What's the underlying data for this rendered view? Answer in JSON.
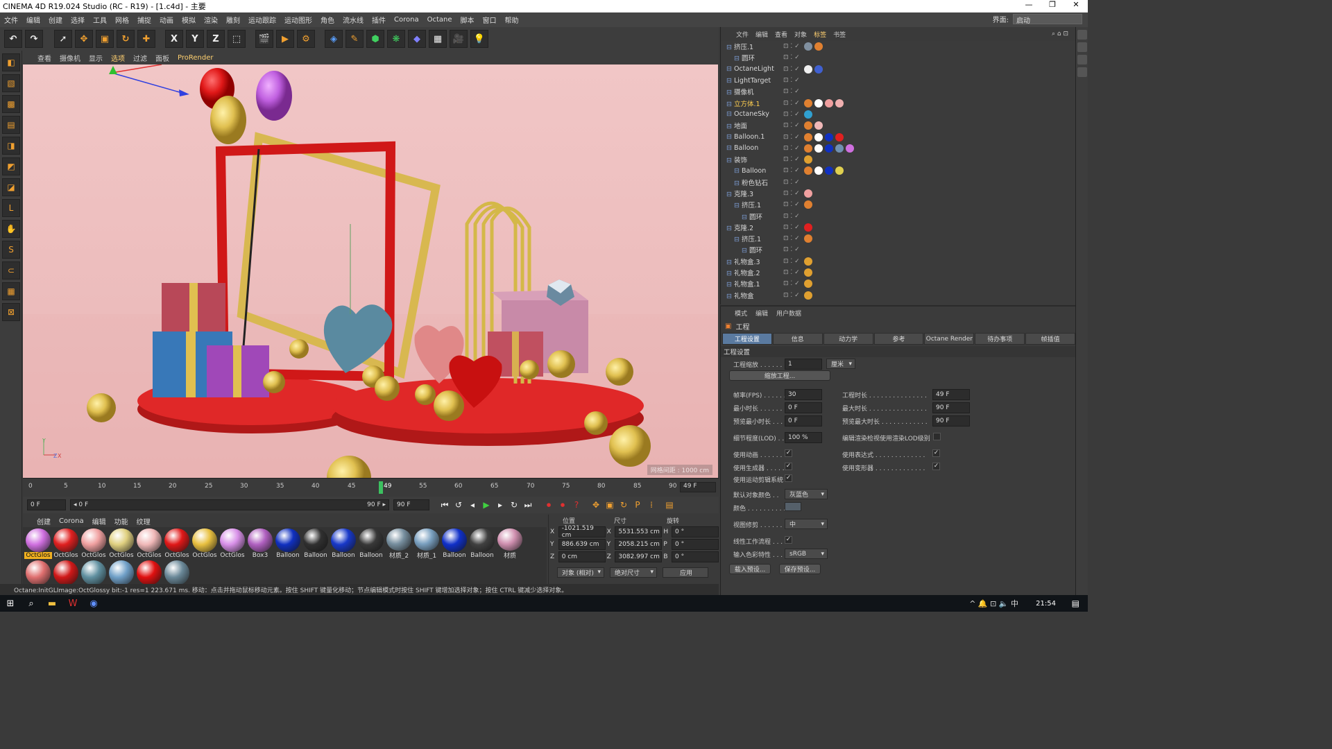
{
  "window": {
    "title": "CINEMA 4D R19.024 Studio (RC - R19) - [1.c4d] - 主要",
    "controls": [
      "—",
      "❐",
      "✕"
    ]
  },
  "menubar": {
    "items": [
      "文件",
      "编辑",
      "创建",
      "选择",
      "工具",
      "网格",
      "捕捉",
      "动画",
      "模拟",
      "渲染",
      "雕刻",
      "运动跟踪",
      "运动图形",
      "角色",
      "流水线",
      "插件",
      "Corona",
      "Octane",
      "脚本",
      "窗口",
      "帮助"
    ],
    "layout_label": "界面:",
    "layout_value": "启动"
  },
  "toolbar": {
    "icons": [
      "undo-icon",
      "redo-icon",
      "select-icon",
      "move-icon",
      "scale-icon",
      "rotate-icon",
      "move-add-icon",
      "x-axis-icon",
      "y-axis-icon",
      "z-axis-icon",
      "coord-system-icon",
      "render-view-icon",
      "render-picture-icon",
      "render-settings-icon",
      "cube-icon",
      "pen-icon",
      "subdivide-icon",
      "array-icon",
      "deformer-icon",
      "floor-icon",
      "camera-icon",
      "light-icon"
    ],
    "axis_labels": [
      "X",
      "Y",
      "Z"
    ]
  },
  "viewport": {
    "menu": [
      "查看",
      "摄像机",
      "显示",
      "选项",
      "过滤",
      "面板",
      "ProRender"
    ],
    "info": "网格间距 : 1000 cm",
    "axis_y": "Y",
    "axis_z": "Z",
    "axis_x": "X"
  },
  "timeline": {
    "ticks": [
      "0",
      "5",
      "10",
      "15",
      "20",
      "25",
      "30",
      "35",
      "40",
      "45",
      "49",
      "55",
      "60",
      "65",
      "70",
      "75",
      "80",
      "85",
      "90"
    ],
    "current_frame": "49 F",
    "start_field": "0 F",
    "range_start": "◂ 0 F",
    "range_end": "90 F ▸",
    "end_field": "90 F"
  },
  "material_menu": [
    "创建",
    "Corona",
    "编辑",
    "功能",
    "纹理"
  ],
  "materials": [
    {
      "name": "OctGlos",
      "color": "#d070e0",
      "selected": true
    },
    {
      "name": "OctGlos",
      "color": "#e02020"
    },
    {
      "name": "OctGlos",
      "color": "#f0a0a0"
    },
    {
      "name": "OctGlos",
      "color": "#e0d080"
    },
    {
      "name": "OctGlos",
      "color": "#f0b8b8"
    },
    {
      "name": "OctGlos",
      "color": "#e01818"
    },
    {
      "name": "OctGlos",
      "color": "#e8c040"
    },
    {
      "name": "OctGlos",
      "color": "#d890e8"
    },
    {
      "name": "Box3",
      "color": "#b060c0"
    },
    {
      "name": "Balloon",
      "color": "#1030c0"
    },
    {
      "name": "Balloon",
      "color": "#303030"
    },
    {
      "name": "Balloon",
      "color": "#1838c8"
    },
    {
      "name": "Balloon",
      "color": "#383838"
    },
    {
      "name": "材质_2",
      "color": "#7890a0"
    },
    {
      "name": "材质_1",
      "color": "#7aa0c0"
    },
    {
      "name": "Balloon",
      "color": "#1030c8"
    },
    {
      "name": "Balloon",
      "color": "#404040"
    },
    {
      "name": "材质",
      "color": "#d090b0"
    },
    {
      "name": "",
      "color": "#e07070"
    },
    {
      "name": "",
      "color": "#d01818"
    },
    {
      "name": "",
      "color": "#6090a0"
    },
    {
      "name": "",
      "color": "#70a0c8"
    },
    {
      "name": "",
      "color": "#e01010"
    },
    {
      "name": "",
      "color": "#6a8898"
    }
  ],
  "coords": {
    "headers": [
      "位置",
      "尺寸",
      "旋转"
    ],
    "rows": [
      {
        "axis": "X",
        "pos": "-1021.519 cm",
        "size_axis": "X",
        "size": "5531.553 cm",
        "rot_axis": "H",
        "rot": "0 °"
      },
      {
        "axis": "Y",
        "pos": "886.639 cm",
        "size_axis": "Y",
        "size": "2058.215 cm",
        "rot_axis": "P",
        "rot": "0 °"
      },
      {
        "axis": "Z",
        "pos": "0 cm",
        "size_axis": "Z",
        "size": "3082.997 cm",
        "rot_axis": "B",
        "rot": "0 °"
      }
    ],
    "mode": "对象 (相对)",
    "size_mode": "绝对尺寸",
    "apply": "应用"
  },
  "status": "Octane:InitGLImage:OctGlossy  bit:-1 res=1  223.671 ms.    移动：点击并拖动鼠标移动元素。按住 SHIFT 键量化移动；节点编辑模式时按住 SHIFT 键增加选择对象；按住 CTRL 键减少选择对象。",
  "objects": {
    "menu": [
      "文件",
      "编辑",
      "查看",
      "对象",
      "标签",
      "书签"
    ],
    "active_menu": "标签",
    "rows": [
      {
        "name": "挤压.1",
        "indent": 0,
        "tags": [
          "#8090a0",
          "#e08030"
        ]
      },
      {
        "name": "圆环",
        "indent": 1,
        "tags": []
      },
      {
        "name": "OctaneLight",
        "indent": 0,
        "tags": [
          "#f0f0f0",
          "#4060d0"
        ]
      },
      {
        "name": "LightTarget",
        "indent": 0,
        "tags": []
      },
      {
        "name": "摄像机",
        "indent": 0,
        "tags": []
      },
      {
        "name": "立方体.1",
        "indent": 0,
        "hl": true,
        "tags": [
          "#e08030",
          "#ffffff",
          "#f0a0a0",
          "#f0b0b0"
        ]
      },
      {
        "name": "OctaneSky",
        "indent": 0,
        "tags": [
          "#30a0d0"
        ]
      },
      {
        "name": "地面",
        "indent": 0,
        "tags": [
          "#e08030",
          "#f0b8b8"
        ]
      },
      {
        "name": "Balloon.1",
        "indent": 0,
        "tags": [
          "#e08030",
          "#ffffff",
          "#1030c0",
          "#e02020"
        ]
      },
      {
        "name": "Balloon",
        "indent": 0,
        "tags": [
          "#e08030",
          "#ffffff",
          "#1030c0",
          "#7090b0",
          "#d070e0"
        ]
      },
      {
        "name": "装饰",
        "indent": 0,
        "tags": [
          "#e0a030"
        ]
      },
      {
        "name": "Balloon",
        "indent": 1,
        "tags": [
          "#e08030",
          "#ffffff",
          "#1030c0",
          "#e0d050"
        ]
      },
      {
        "name": "粉色钻石",
        "indent": 1,
        "tags": []
      },
      {
        "name": "克隆.3",
        "indent": 0,
        "tags": [
          "#f0a0a0"
        ]
      },
      {
        "name": "挤压.1",
        "indent": 1,
        "tags": [
          "#e08030"
        ]
      },
      {
        "name": "圆环",
        "indent": 2,
        "tags": []
      },
      {
        "name": "克隆.2",
        "indent": 0,
        "tags": [
          "#e02020"
        ]
      },
      {
        "name": "挤压.1",
        "indent": 1,
        "tags": [
          "#e08030"
        ]
      },
      {
        "name": "圆环",
        "indent": 2,
        "tags": []
      },
      {
        "name": "礼物盒.3",
        "indent": 0,
        "tags": [
          "#e0a030"
        ]
      },
      {
        "name": "礼物盒.2",
        "indent": 0,
        "tags": [
          "#e0a030"
        ]
      },
      {
        "name": "礼物盒.1",
        "indent": 0,
        "tags": [
          "#e0a030"
        ]
      },
      {
        "name": "礼物盒",
        "indent": 0,
        "tags": [
          "#e0a030"
        ]
      }
    ]
  },
  "attributes": {
    "menu": [
      "模式",
      "编辑",
      "用户数据"
    ],
    "title": "工程",
    "tabs": [
      "工程设置",
      "信息",
      "动力学",
      "参考",
      "Octane Render",
      "待办事项",
      "帧插值"
    ],
    "section": "工程设置",
    "scale_label": "工程缩放 . . . . . . .",
    "scale_value": "1",
    "scale_unit": "厘米",
    "scale_button": "缩放工程...",
    "fields": [
      {
        "label": "帧率(FPS) . . . . . . .",
        "value": "30",
        "label2": "工程时长 . . . . . . . . . . . . . . .",
        "value2": "49 F"
      },
      {
        "label": "最小时长 . . . . . . . .",
        "value": "0 F",
        "label2": "最大时长 . . . . . . . . . . . . . . .",
        "value2": "90 F"
      },
      {
        "label": "预览最小时长 . . . .",
        "value": "0 F",
        "label2": "预览最大时长 . . . . . . . . . . . .",
        "value2": "90 F"
      }
    ],
    "lod_label": "细节程度(LOD) . . .",
    "lod_value": "100 %",
    "lod_check_label": "编辑渲染检视使用渲染LOD级别",
    "checks": [
      {
        "label": "使用动画 . . . . . . .",
        "label2": "使用表达式 . . . . . . . . . . . . ."
      },
      {
        "label": "使用生成器 . . . . . .",
        "label2": "使用变形器 . . . . . . . . . . . . ."
      },
      {
        "label": "使用运动剪辑系统",
        "label2": ""
      }
    ],
    "default_color_label": "默认对象颜色 . .",
    "default_color_value": "灰蓝色",
    "color_label": "颜色 . . . . . . . . . .",
    "clip_label": "视图修剪 . . . . . . .",
    "clip_value": "中",
    "linear_label": "线性工作流程 . . . .",
    "input_label": "输入色彩特性 . . .",
    "input_value": "sRGB",
    "load_btn": "载入预设...",
    "save_btn": "保存预设..."
  },
  "taskbar": {
    "time": "21:54",
    "tray": "^ 🔔 ⊡ 🔈 中"
  }
}
